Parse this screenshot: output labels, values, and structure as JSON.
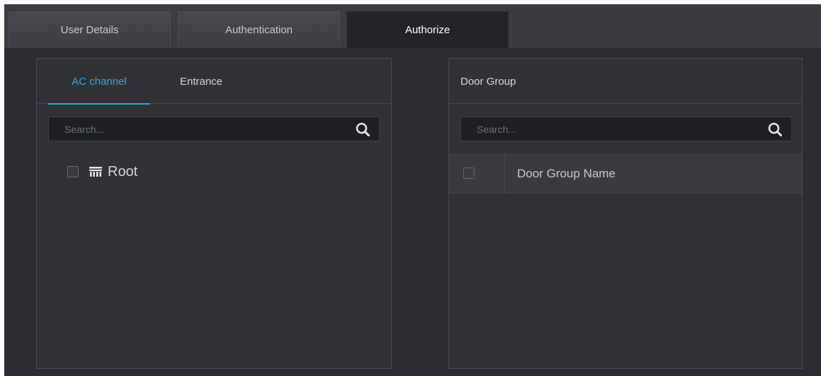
{
  "tabs": {
    "user_details": "User Details",
    "authentication": "Authentication",
    "authorize": "Authorize"
  },
  "left_panel": {
    "subtabs": {
      "ac_channel": "AC channel",
      "entrance": "Entrance"
    },
    "search_placeholder": "Search...",
    "tree": {
      "root_label": "Root",
      "root_icon": "device-tree-icon"
    }
  },
  "right_panel": {
    "title": "Door Group",
    "search_placeholder": "Search...",
    "table": {
      "columns": [
        "Door Group Name"
      ],
      "rows": []
    }
  },
  "colors": {
    "accent": "#2fa8e6",
    "background": "#2b2d31",
    "panel": "#303236"
  }
}
